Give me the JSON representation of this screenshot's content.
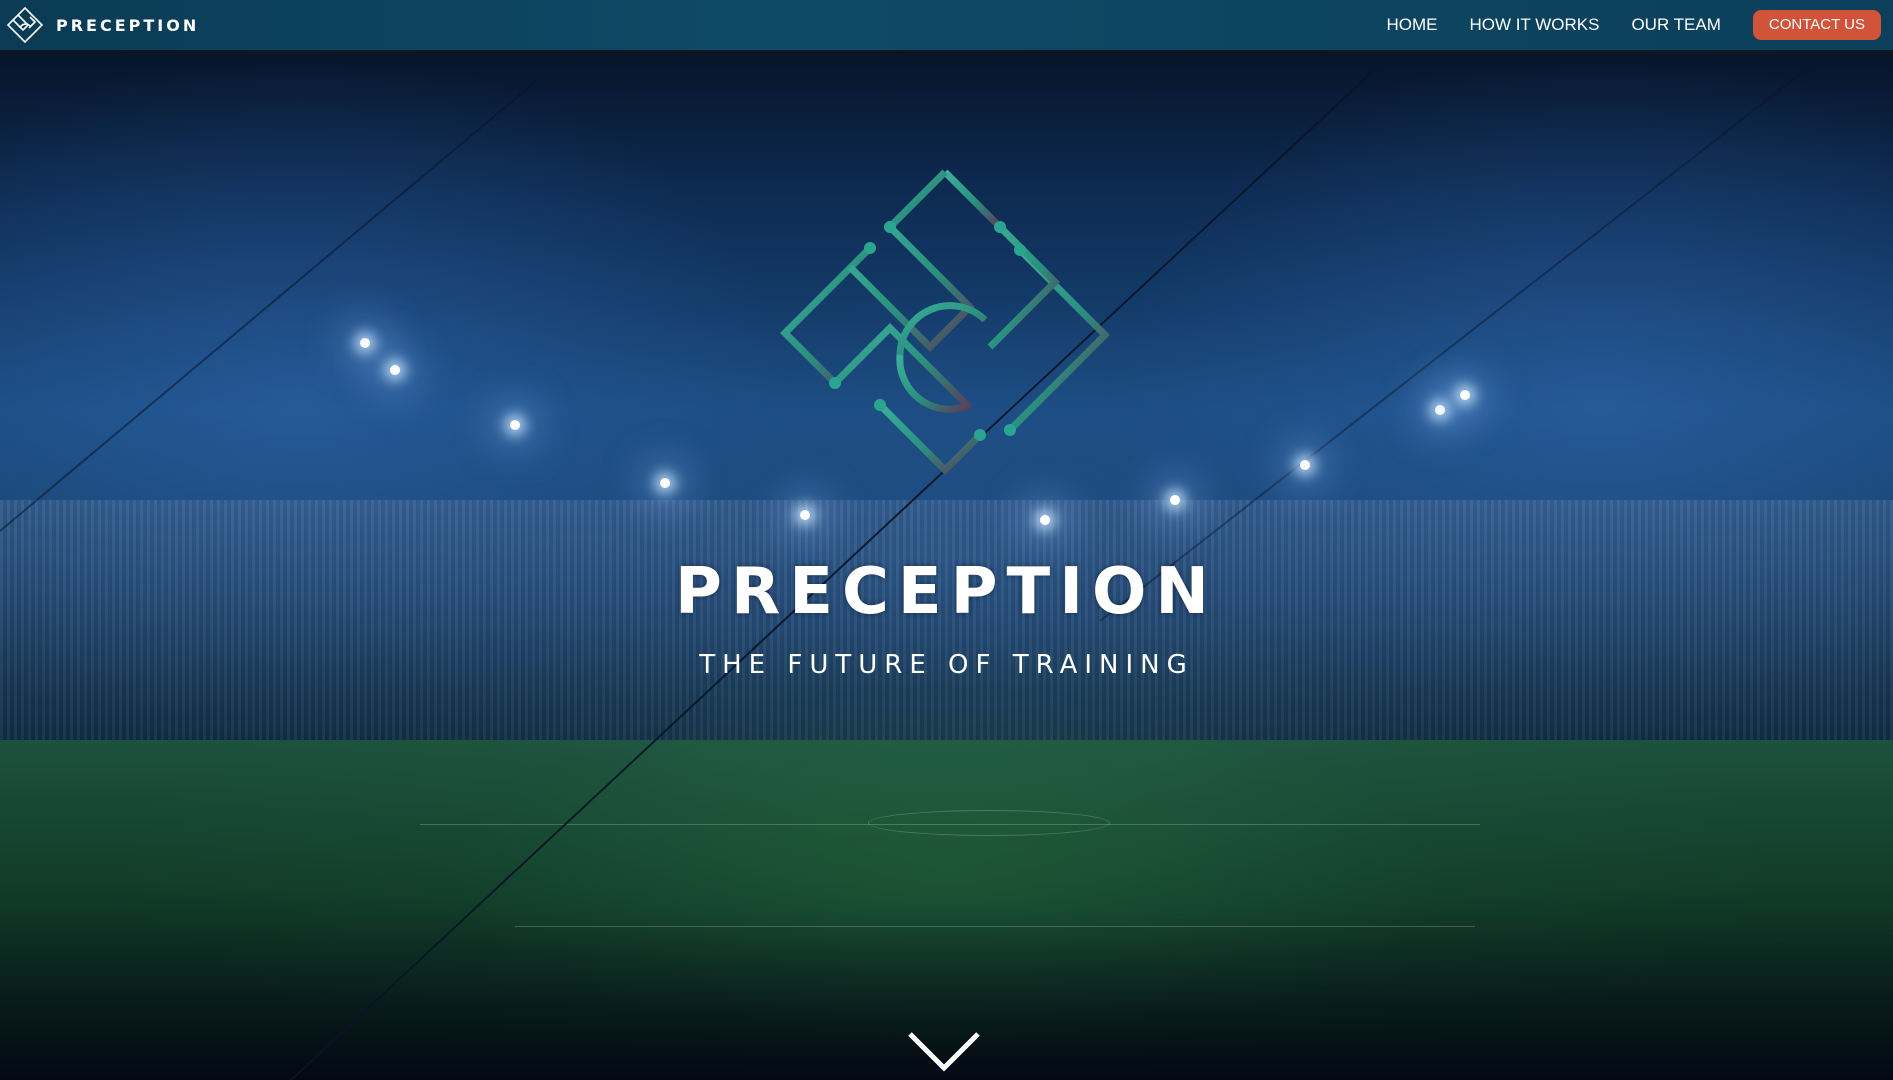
{
  "navbar": {
    "brand_name": "PRECEPTION",
    "brand_icon": "preception-logo-icon",
    "links": [
      {
        "label": "HOME"
      },
      {
        "label": "HOW IT WORKS"
      },
      {
        "label": "OUR TEAM"
      }
    ],
    "cta_label": "CONTACT US"
  },
  "hero": {
    "title": "PRECEPTION",
    "subtitle": "THE FUTURE OF TRAINING",
    "logo_icon": "preception-emblem-icon",
    "scroll_icon": "chevron-down-icon"
  },
  "colors": {
    "navbar_bg": "#0e4a66",
    "cta_bg": "#d0533a",
    "text": "#ffffff",
    "logo_stroke": "#2aa58f"
  }
}
